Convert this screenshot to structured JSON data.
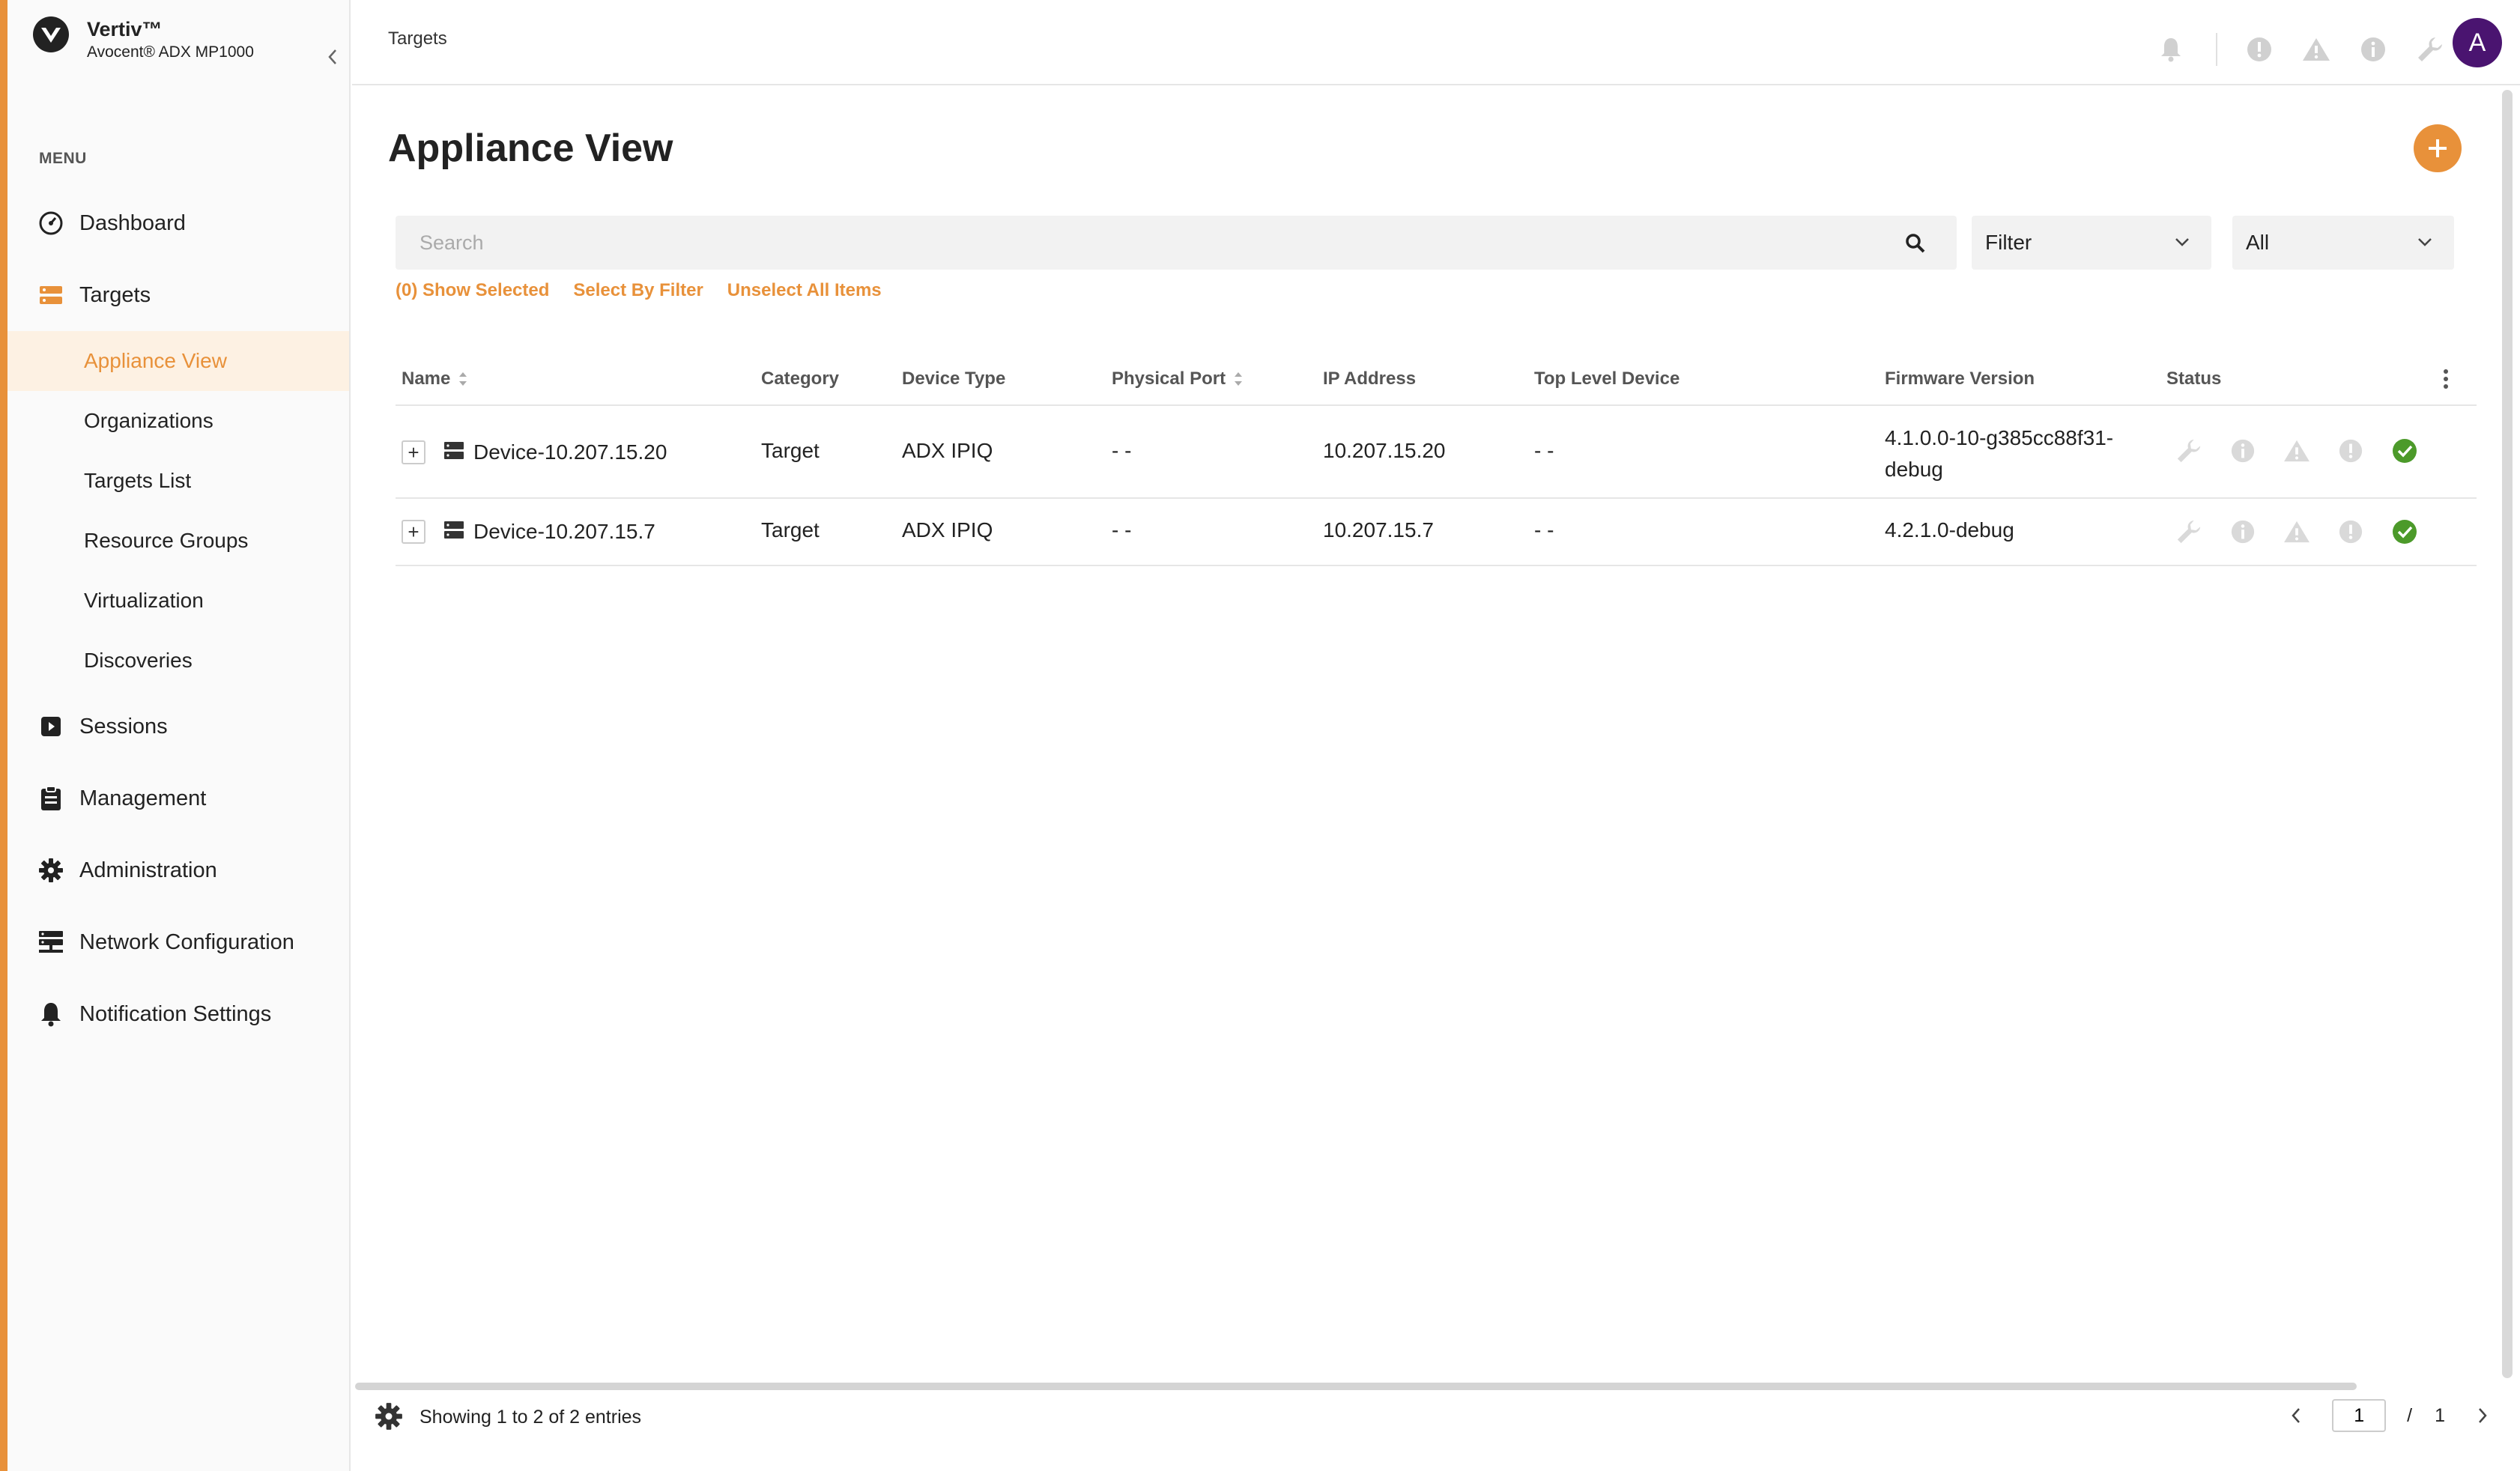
{
  "brand": {
    "name": "Vertiv™",
    "product": "Avocent® ADX MP1000"
  },
  "sidebar": {
    "menu_label": "MENU",
    "items": [
      {
        "label": "Dashboard",
        "icon": "dashboard-icon"
      },
      {
        "label": "Targets",
        "icon": "targets-icon"
      }
    ],
    "sub_items": [
      {
        "label": "Appliance View",
        "active": true
      },
      {
        "label": "Organizations"
      },
      {
        "label": "Targets List"
      },
      {
        "label": "Resource Groups"
      },
      {
        "label": "Virtualization"
      },
      {
        "label": "Discoveries"
      }
    ],
    "items_after": [
      {
        "label": "Sessions",
        "icon": "sessions-icon"
      },
      {
        "label": "Management",
        "icon": "clipboard-icon"
      },
      {
        "label": "Administration",
        "icon": "gear-icon"
      },
      {
        "label": "Network Configuration",
        "icon": "network-icon"
      },
      {
        "label": "Notification Settings",
        "icon": "bell-icon"
      }
    ]
  },
  "header": {
    "breadcrumb": "Targets",
    "avatar_letter": "A"
  },
  "main": {
    "title": "Appliance View",
    "search": {
      "placeholder": "Search",
      "value": ""
    },
    "filter_select": "Filter",
    "scope_select": "All",
    "links": {
      "show_selected": "(0) Show Selected",
      "select_by_filter": "Select By Filter",
      "unselect_all": "Unselect All Items"
    }
  },
  "table": {
    "columns": {
      "name": "Name",
      "category": "Category",
      "device_type": "Device Type",
      "physical_port": "Physical Port",
      "ip_address": "IP Address",
      "top_level_device": "Top Level Device",
      "firmware": "Firmware Version",
      "status": "Status"
    },
    "rows": [
      {
        "expander": "+",
        "name": "Device-10.207.15.20",
        "category": "Target",
        "device_type": "ADX IPIQ",
        "physical_port": "- -",
        "ip": "10.207.15.20",
        "top_level": "- -",
        "firmware_line1": "4.1.0.0-10-g385cc88f31-",
        "firmware_line2": "debug",
        "status": "ok"
      },
      {
        "expander": "+",
        "name": "Device-10.207.15.7",
        "category": "Target",
        "device_type": "ADX IPIQ",
        "physical_port": "- -",
        "ip": "10.207.15.7",
        "top_level": "- -",
        "firmware_line1": "4.2.1.0-debug",
        "firmware_line2": "",
        "status": "ok"
      }
    ]
  },
  "footer": {
    "entries": "Showing 1 to 2 of 2 entries",
    "page": "1",
    "page_sep": "/",
    "total_pages": "1"
  },
  "colors": {
    "accent": "#e8913a",
    "avatar": "#4a1470",
    "ok": "#4c9a2a",
    "muted_icon": "#d0d0d0"
  }
}
